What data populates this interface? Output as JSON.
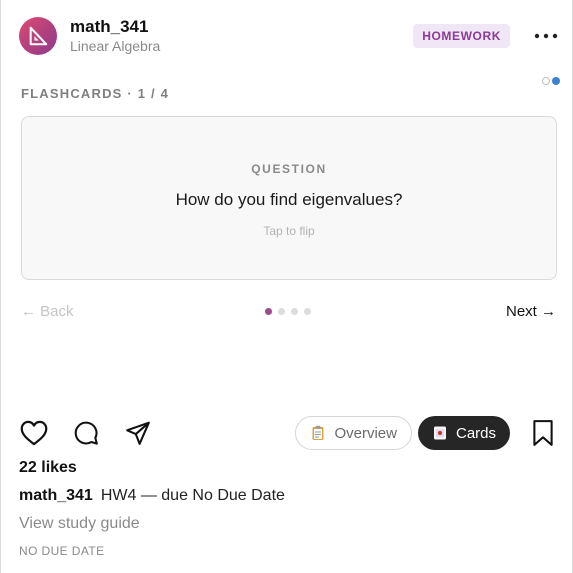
{
  "header": {
    "username": "math_341",
    "subtitle": "Linear Algebra",
    "badge": "HOMEWORK",
    "avatar_icon": "set-square-icon",
    "more_icon": "more-horizontal-icon",
    "avatar_gradient": [
      "#e04a72",
      "#8e3a8f"
    ]
  },
  "view_toggle": {
    "icons": [
      "circle-outline-icon",
      "circle-filled-icon"
    ],
    "active_color": "#3b82d6"
  },
  "flashcards": {
    "label": "FLASHCARDS · 1 / 4",
    "current": 1,
    "total": 4,
    "card": {
      "kicker": "QUESTION",
      "question": "How do you find eigenvalues?",
      "hint": "Tap to flip"
    },
    "back_label": "← Back",
    "next_label": "Next →",
    "dot_active_color": "#9b4a90"
  },
  "actions": {
    "like_icon": "heart-icon",
    "comment_icon": "comment-bubble-icon",
    "share_icon": "paper-plane-icon",
    "overview_label": "Overview",
    "overview_icon": "clipboard-icon",
    "cards_label": "Cards",
    "cards_icon": "cards-icon",
    "bookmark_icon": "bookmark-icon"
  },
  "post": {
    "likes": "22 likes",
    "caption_user": "math_341",
    "caption_text": "HW4 — due No Due Date",
    "view_link": "View study guide",
    "due_label": "NO DUE DATE"
  }
}
